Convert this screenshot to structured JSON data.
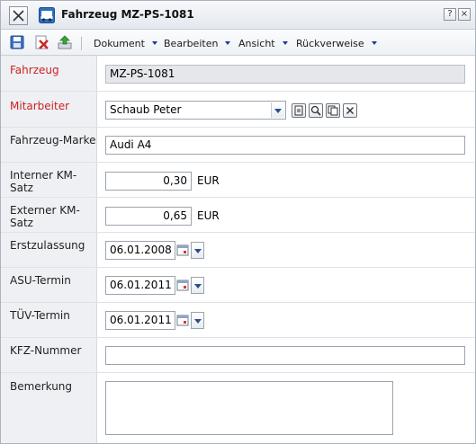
{
  "window": {
    "title": "Fahrzeug MZ-PS-1081",
    "help_label": "?",
    "close_label": "×"
  },
  "toolbar": {
    "icons": [
      "save-icon",
      "delete-icon",
      "upload-icon"
    ],
    "menus": [
      "Dokument",
      "Bearbeiten",
      "Ansicht",
      "Rückverweise"
    ]
  },
  "form": {
    "fahrzeug": {
      "label": "Fahrzeug",
      "value": "MZ-PS-1081"
    },
    "mitarbeiter": {
      "label": "Mitarbeiter",
      "value": "Schaub Peter"
    },
    "marke": {
      "label": "Fahrzeug-Marke",
      "value": "Audi A4"
    },
    "km_intern": {
      "label": "Interner KM-Satz",
      "value": "0,30",
      "unit": "EUR"
    },
    "km_extern": {
      "label": "Externer KM-Satz",
      "value": "0,65",
      "unit": "EUR"
    },
    "erstzulassung": {
      "label": "Erstzulassung",
      "value": "06.01.2008"
    },
    "asu": {
      "label": "ASU-Termin",
      "value": "06.01.2011"
    },
    "tuev": {
      "label": "TÜV-Termin",
      "value": "06.01.2011"
    },
    "kfz_nummer": {
      "label": "KFZ-Nummer",
      "value": ""
    },
    "bemerkung": {
      "label": "Bemerkung",
      "value": ""
    }
  },
  "colors": {
    "required_label": "#cc2222",
    "label_bg": "#eef0f3",
    "accent": "#1c3d8c"
  }
}
